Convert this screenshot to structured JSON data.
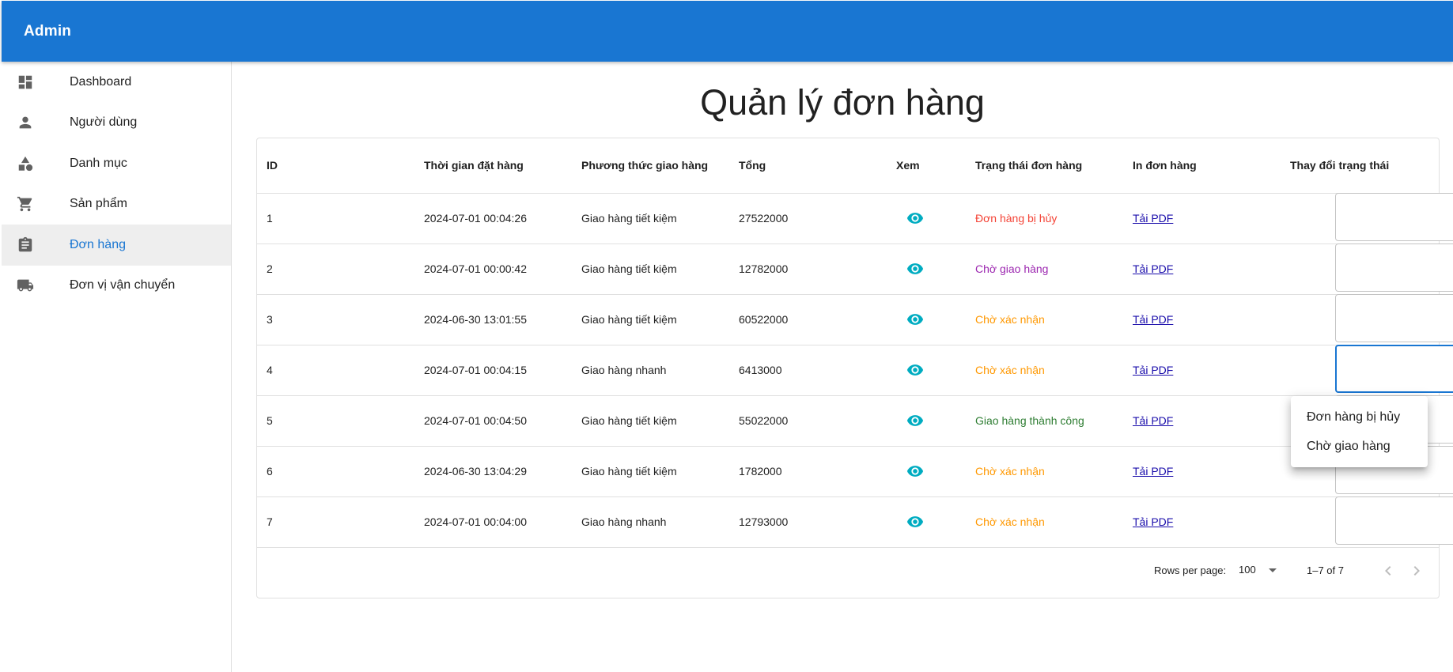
{
  "appbar": {
    "title": "Admin"
  },
  "sidebar": {
    "items": [
      {
        "label": "Dashboard",
        "icon": "dashboard-icon",
        "active": false
      },
      {
        "label": "Người dùng",
        "icon": "person-icon",
        "active": false
      },
      {
        "label": "Danh mục",
        "icon": "category-icon",
        "active": false
      },
      {
        "label": "Sản phẩm",
        "icon": "cart-icon",
        "active": false
      },
      {
        "label": "Đơn hàng",
        "icon": "assignment-icon",
        "active": true
      },
      {
        "label": "Đơn vị vận chuyển",
        "icon": "truck-icon",
        "active": false
      }
    ]
  },
  "page": {
    "title": "Quản lý đơn hàng"
  },
  "table": {
    "headers": [
      "ID",
      "Thời gian đặt hàng",
      "Phương thức giao hàng",
      "Tổng",
      "Xem",
      "Trạng thái đơn hàng",
      "In đơn hàng",
      "Thay đổi trạng thái"
    ],
    "rows": [
      {
        "id": "1",
        "time": "2024-07-01 00:04:26",
        "method": "Giao hàng tiết kiệm",
        "total": "27522000",
        "status": "Đơn hàng bị hủy",
        "status_color": "#f44336",
        "print": "Tải PDF"
      },
      {
        "id": "2",
        "time": "2024-07-01 00:00:42",
        "method": "Giao hàng tiết kiệm",
        "total": "12782000",
        "status": "Chờ giao hàng",
        "status_color": "#9c27b0",
        "print": "Tải PDF"
      },
      {
        "id": "3",
        "time": "2024-06-30 13:01:55",
        "method": "Giao hàng tiết kiệm",
        "total": "60522000",
        "status": "Chờ xác nhận",
        "status_color": "#ff9800",
        "print": "Tải PDF"
      },
      {
        "id": "4",
        "time": "2024-07-01 00:04:15",
        "method": "Giao hàng nhanh",
        "total": "6413000",
        "status": "Chờ xác nhận",
        "status_color": "#ff9800",
        "print": "Tải PDF"
      },
      {
        "id": "5",
        "time": "2024-07-01 00:04:50",
        "method": "Giao hàng tiết kiệm",
        "total": "55022000",
        "status": "Giao hàng thành công",
        "status_color": "#2e7d32",
        "print": "Tải PDF"
      },
      {
        "id": "6",
        "time": "2024-06-30 13:04:29",
        "method": "Giao hàng tiết kiệm",
        "total": "1782000",
        "status": "Chờ xác nhận",
        "status_color": "#ff9800",
        "print": "Tải PDF"
      },
      {
        "id": "7",
        "time": "2024-07-01 00:04:00",
        "method": "Giao hàng nhanh",
        "total": "12793000",
        "status": "Chờ xác nhận",
        "status_color": "#ff9800",
        "print": "Tải PDF"
      }
    ]
  },
  "pagination": {
    "rows_per_page_label": "Rows per page:",
    "rows_per_page_value": "100",
    "range": "1–7 of 7"
  },
  "status_menu": {
    "options": [
      "Đơn hàng bị hủy",
      "Chờ giao hàng"
    ]
  },
  "colors": {
    "primary": "#1976d2",
    "eye_icon": "#00acc1",
    "link": "#1a0dab"
  }
}
